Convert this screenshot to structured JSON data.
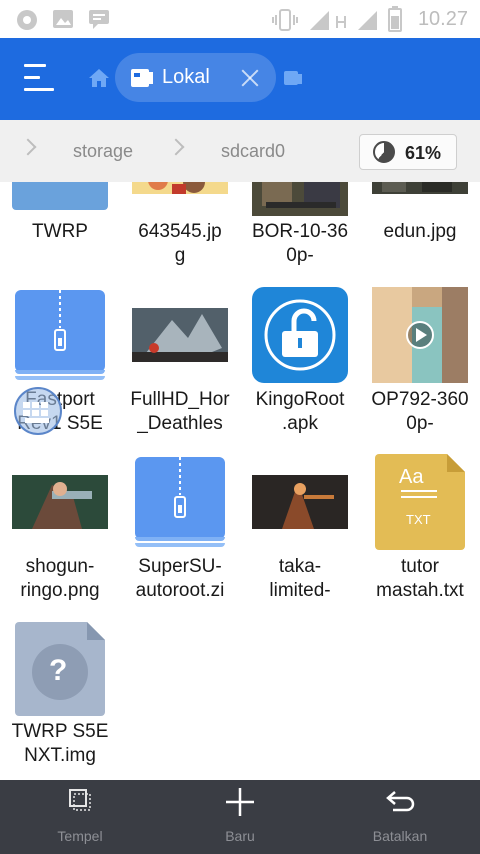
{
  "status_bar": {
    "time": "10.27",
    "icons": [
      "record-icon",
      "image-icon",
      "chat-icon",
      "vibrate-icon",
      "signal-icon",
      "signal-h-icon",
      "signal-2-icon",
      "battery-icon"
    ]
  },
  "app_bar": {
    "menu_icon": "hamburger-menu-icon",
    "home_icon": "home-icon",
    "tab": {
      "label": "Lokal",
      "icon": "storage-icon",
      "close_icon": "close-icon"
    },
    "next_tab_icon": "tab-icon"
  },
  "breadcrumb": {
    "items": [
      "storage",
      "sdcard0"
    ],
    "storage_usage": "61%"
  },
  "files": [
    {
      "name_lines": [
        "TWRP"
      ],
      "type": "folder"
    },
    {
      "name_lines": [
        "643545.jp",
        "g"
      ],
      "type": "image"
    },
    {
      "name_lines": [
        "BOR-10-36",
        "0p-"
      ],
      "type": "video"
    },
    {
      "name_lines": [
        "edun.jpg"
      ],
      "type": "image"
    },
    {
      "name_lines": [
        "Fastport",
        "Rev1 S5E"
      ],
      "type": "zip"
    },
    {
      "name_lines": [
        "FullHD_Hor",
        "_Deathles"
      ],
      "type": "image"
    },
    {
      "name_lines": [
        "KingoRoot",
        ".apk"
      ],
      "type": "apk"
    },
    {
      "name_lines": [
        "OP792-360",
        "0p-"
      ],
      "type": "video"
    },
    {
      "name_lines": [
        "shogun-",
        "ringo.png"
      ],
      "type": "image"
    },
    {
      "name_lines": [
        "SuperSU-",
        "autoroot.zi"
      ],
      "type": "zip"
    },
    {
      "name_lines": [
        "taka-",
        "limited-"
      ],
      "type": "image"
    },
    {
      "name_lines": [
        "tutor",
        "mastah.txt"
      ],
      "type": "txt",
      "icon_label": "TXT",
      "icon_glyph": "Aa"
    },
    {
      "name_lines": [
        "TWRP S5E",
        "NXT.img"
      ],
      "type": "unknown",
      "icon_glyph": "?"
    }
  ],
  "bottom_bar": {
    "buttons": [
      {
        "label": "Tempel",
        "icon": "paste-icon"
      },
      {
        "label": "Baru",
        "icon": "plus-icon"
      },
      {
        "label": "Batalkan",
        "icon": "undo-icon"
      }
    ]
  },
  "colors": {
    "app_bar": "#1e6be0",
    "bottom_bar": "#3a3d44",
    "zip_icon": "#5b97f0",
    "txt_icon": "#e3bc55",
    "apk_icon": "#1f86d8"
  }
}
